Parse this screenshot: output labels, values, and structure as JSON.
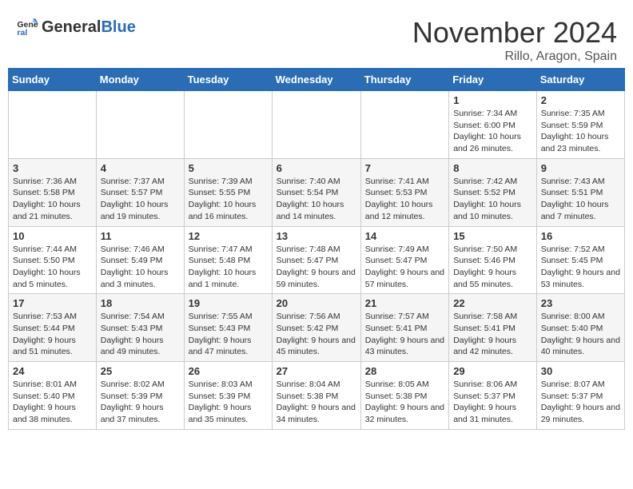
{
  "header": {
    "logo_general": "General",
    "logo_blue": "Blue",
    "month_title": "November 2024",
    "location": "Rillo, Aragon, Spain"
  },
  "days_of_week": [
    "Sunday",
    "Monday",
    "Tuesday",
    "Wednesday",
    "Thursday",
    "Friday",
    "Saturday"
  ],
  "weeks": [
    [
      {
        "day": "",
        "info": ""
      },
      {
        "day": "",
        "info": ""
      },
      {
        "day": "",
        "info": ""
      },
      {
        "day": "",
        "info": ""
      },
      {
        "day": "",
        "info": ""
      },
      {
        "day": "1",
        "info": "Sunrise: 7:34 AM\nSunset: 6:00 PM\nDaylight: 10 hours and 26 minutes."
      },
      {
        "day": "2",
        "info": "Sunrise: 7:35 AM\nSunset: 5:59 PM\nDaylight: 10 hours and 23 minutes."
      }
    ],
    [
      {
        "day": "3",
        "info": "Sunrise: 7:36 AM\nSunset: 5:58 PM\nDaylight: 10 hours and 21 minutes."
      },
      {
        "day": "4",
        "info": "Sunrise: 7:37 AM\nSunset: 5:57 PM\nDaylight: 10 hours and 19 minutes."
      },
      {
        "day": "5",
        "info": "Sunrise: 7:39 AM\nSunset: 5:55 PM\nDaylight: 10 hours and 16 minutes."
      },
      {
        "day": "6",
        "info": "Sunrise: 7:40 AM\nSunset: 5:54 PM\nDaylight: 10 hours and 14 minutes."
      },
      {
        "day": "7",
        "info": "Sunrise: 7:41 AM\nSunset: 5:53 PM\nDaylight: 10 hours and 12 minutes."
      },
      {
        "day": "8",
        "info": "Sunrise: 7:42 AM\nSunset: 5:52 PM\nDaylight: 10 hours and 10 minutes."
      },
      {
        "day": "9",
        "info": "Sunrise: 7:43 AM\nSunset: 5:51 PM\nDaylight: 10 hours and 7 minutes."
      }
    ],
    [
      {
        "day": "10",
        "info": "Sunrise: 7:44 AM\nSunset: 5:50 PM\nDaylight: 10 hours and 5 minutes."
      },
      {
        "day": "11",
        "info": "Sunrise: 7:46 AM\nSunset: 5:49 PM\nDaylight: 10 hours and 3 minutes."
      },
      {
        "day": "12",
        "info": "Sunrise: 7:47 AM\nSunset: 5:48 PM\nDaylight: 10 hours and 1 minute."
      },
      {
        "day": "13",
        "info": "Sunrise: 7:48 AM\nSunset: 5:47 PM\nDaylight: 9 hours and 59 minutes."
      },
      {
        "day": "14",
        "info": "Sunrise: 7:49 AM\nSunset: 5:47 PM\nDaylight: 9 hours and 57 minutes."
      },
      {
        "day": "15",
        "info": "Sunrise: 7:50 AM\nSunset: 5:46 PM\nDaylight: 9 hours and 55 minutes."
      },
      {
        "day": "16",
        "info": "Sunrise: 7:52 AM\nSunset: 5:45 PM\nDaylight: 9 hours and 53 minutes."
      }
    ],
    [
      {
        "day": "17",
        "info": "Sunrise: 7:53 AM\nSunset: 5:44 PM\nDaylight: 9 hours and 51 minutes."
      },
      {
        "day": "18",
        "info": "Sunrise: 7:54 AM\nSunset: 5:43 PM\nDaylight: 9 hours and 49 minutes."
      },
      {
        "day": "19",
        "info": "Sunrise: 7:55 AM\nSunset: 5:43 PM\nDaylight: 9 hours and 47 minutes."
      },
      {
        "day": "20",
        "info": "Sunrise: 7:56 AM\nSunset: 5:42 PM\nDaylight: 9 hours and 45 minutes."
      },
      {
        "day": "21",
        "info": "Sunrise: 7:57 AM\nSunset: 5:41 PM\nDaylight: 9 hours and 43 minutes."
      },
      {
        "day": "22",
        "info": "Sunrise: 7:58 AM\nSunset: 5:41 PM\nDaylight: 9 hours and 42 minutes."
      },
      {
        "day": "23",
        "info": "Sunrise: 8:00 AM\nSunset: 5:40 PM\nDaylight: 9 hours and 40 minutes."
      }
    ],
    [
      {
        "day": "24",
        "info": "Sunrise: 8:01 AM\nSunset: 5:40 PM\nDaylight: 9 hours and 38 minutes."
      },
      {
        "day": "25",
        "info": "Sunrise: 8:02 AM\nSunset: 5:39 PM\nDaylight: 9 hours and 37 minutes."
      },
      {
        "day": "26",
        "info": "Sunrise: 8:03 AM\nSunset: 5:39 PM\nDaylight: 9 hours and 35 minutes."
      },
      {
        "day": "27",
        "info": "Sunrise: 8:04 AM\nSunset: 5:38 PM\nDaylight: 9 hours and 34 minutes."
      },
      {
        "day": "28",
        "info": "Sunrise: 8:05 AM\nSunset: 5:38 PM\nDaylight: 9 hours and 32 minutes."
      },
      {
        "day": "29",
        "info": "Sunrise: 8:06 AM\nSunset: 5:37 PM\nDaylight: 9 hours and 31 minutes."
      },
      {
        "day": "30",
        "info": "Sunrise: 8:07 AM\nSunset: 5:37 PM\nDaylight: 9 hours and 29 minutes."
      }
    ]
  ]
}
